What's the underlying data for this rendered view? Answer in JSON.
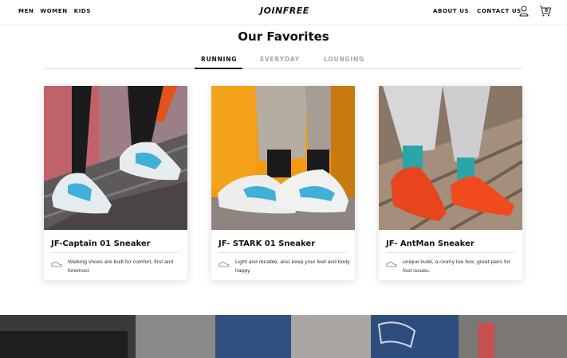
{
  "header": {
    "nav_left": [
      "MEN",
      "WOMEN",
      "KIDS"
    ],
    "logo": "JOINFREE",
    "nav_right": [
      "ABOUT US",
      "CONTACT US"
    ],
    "cart_count": "0"
  },
  "section": {
    "title": "Our Favorites",
    "tabs": [
      {
        "label": "RUNNING",
        "active": true
      },
      {
        "label": "EVERYDAY",
        "active": false
      },
      {
        "label": "LOUNGING",
        "active": false
      }
    ]
  },
  "products": [
    {
      "title": "JF-Captain 01 Sneaker",
      "description": "Walking shoes are built for comfort, first and foremost"
    },
    {
      "title": "JF- STARK 01 Sneaker",
      "description": "Light and durable, also keep your feet and body happy"
    },
    {
      "title": "JF- AntMan Sneaker",
      "description": "unique build, a roomy toe box, great pairs for foot issues."
    }
  ],
  "colors": {
    "accent": "#111111",
    "tab_inactive": "#a8a8a8"
  }
}
